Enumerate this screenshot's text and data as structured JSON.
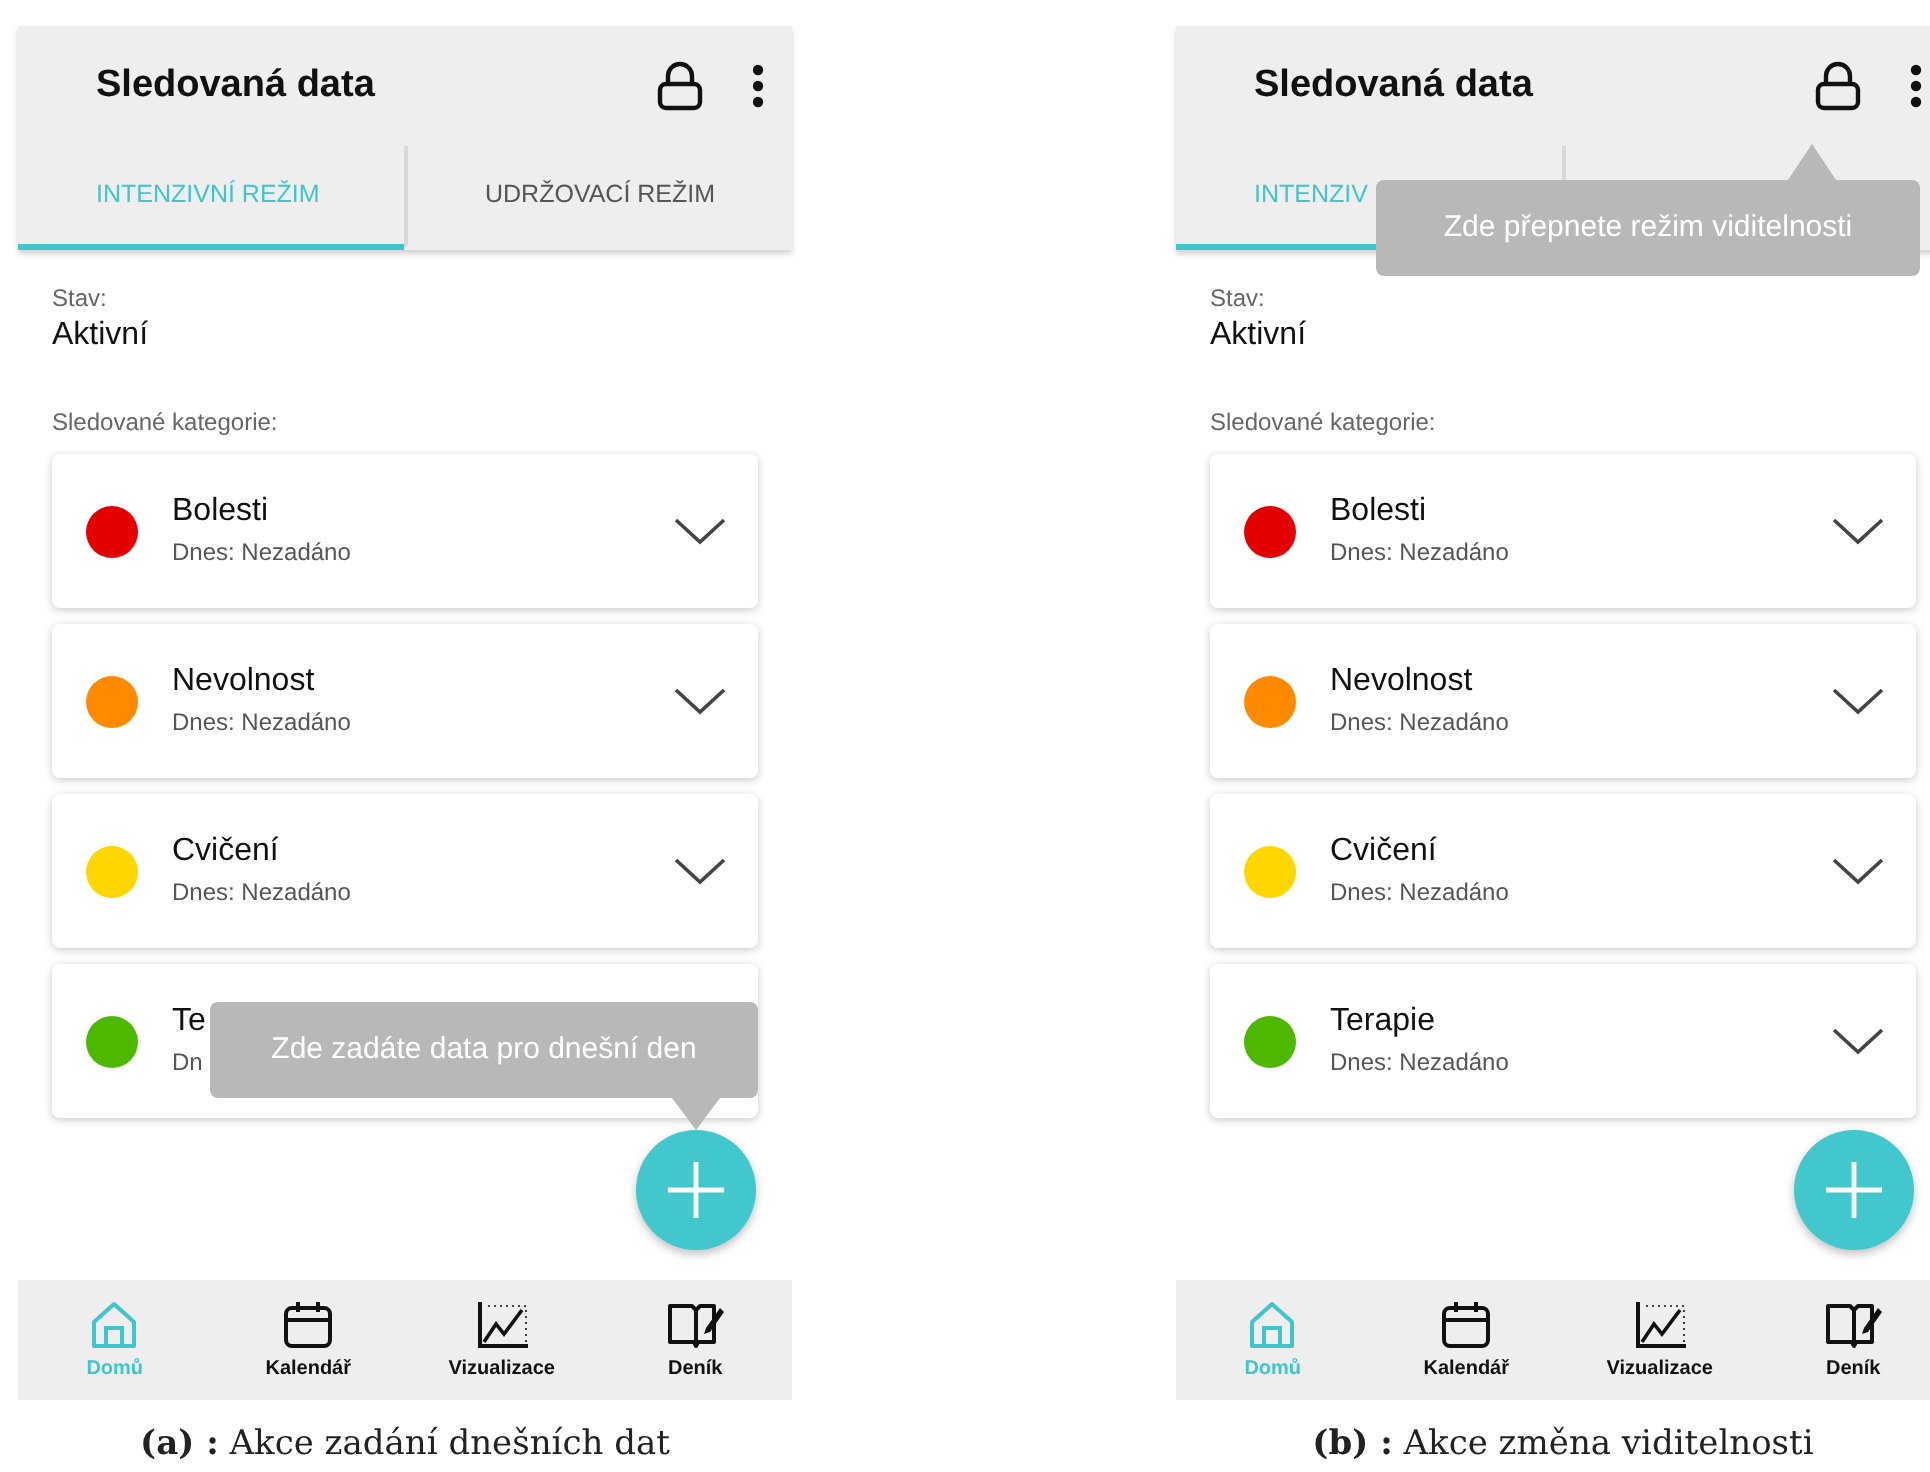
{
  "panels": [
    {
      "title": "Sledovaná data",
      "tabs": [
        {
          "label": "INTENZIVNÍ REŽIM",
          "selected": true
        },
        {
          "label": "UDRŽOVACÍ REŽIM",
          "selected": false
        }
      ],
      "status_label": "Stav:",
      "status_value": "Aktivní",
      "categories_label": "Sledované kategorie:",
      "categories": [
        {
          "name": "Bolesti",
          "subtitle": "Dnes: Nezadáno",
          "color": "#e30000"
        },
        {
          "name": "Nevolnost",
          "subtitle": "Dnes: Nezadáno",
          "color": "#ff8a00"
        },
        {
          "name": "Cvičení",
          "subtitle": "Dnes: Nezadáno",
          "color": "#ffd600"
        },
        {
          "name": "Te",
          "subtitle": "Dn",
          "color": "#4cb800"
        }
      ],
      "tooltip": {
        "text": "Zde zadáte data pro dnešní den",
        "kind": "fab"
      },
      "nav": [
        {
          "label": "Domů",
          "kind": "home",
          "selected": true
        },
        {
          "label": "Kalendář",
          "kind": "calendar",
          "selected": false
        },
        {
          "label": "Vizualizace",
          "kind": "chart",
          "selected": false
        },
        {
          "label": "Deník",
          "kind": "diary",
          "selected": false
        }
      ],
      "caption": "**(a) :** Akce zadání dnešních dat"
    },
    {
      "title": "Sledovaná data",
      "tabs": [
        {
          "label": "INTENZIV",
          "selected": true
        },
        {
          "selected": false
        }
      ],
      "status_label": "Stav:",
      "status_value": "Aktivní",
      "categories_label": "Sledované kategorie:",
      "categories": [
        {
          "name": "Bolesti",
          "subtitle": "Dnes: Nezadáno",
          "color": "#e30000"
        },
        {
          "name": "Nevolnost",
          "subtitle": "Dnes: Nezadáno",
          "color": "#ff8a00"
        },
        {
          "name": "Cvičení",
          "subtitle": "Dnes: Nezadáno",
          "color": "#ffd600"
        },
        {
          "name": "Terapie",
          "subtitle": "Dnes: Nezadáno",
          "color": "#4cb800"
        }
      ],
      "tooltip": {
        "text": "Zde přepnete režim viditelnosti",
        "kind": "lock"
      },
      "nav": [
        {
          "label": "Domů",
          "kind": "home",
          "selected": true
        },
        {
          "label": "Kalendář",
          "kind": "calendar",
          "selected": false
        },
        {
          "label": "Vizualizace",
          "kind": "chart",
          "selected": false
        },
        {
          "label": "Deník",
          "kind": "diary",
          "selected": false
        }
      ],
      "caption": "**(b) :** Akce změna viditelnosti"
    }
  ]
}
